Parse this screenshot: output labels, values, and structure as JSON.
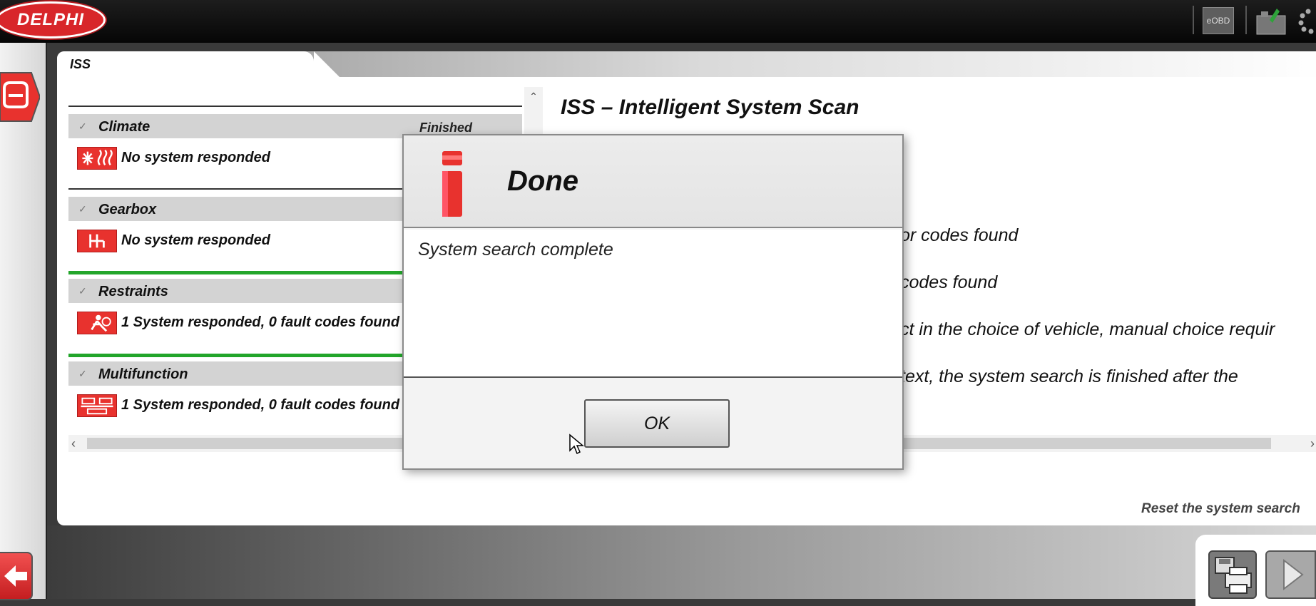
{
  "app": {
    "brand": "DELPHI"
  },
  "toolbar": {
    "eobd_label": "eOBD"
  },
  "tab": {
    "label": "ISS"
  },
  "groups": [
    {
      "name": "Climate",
      "state": "Finished",
      "result": "No system responded"
    },
    {
      "name": "Gearbox",
      "state": "",
      "result": "No system responded"
    },
    {
      "name": "Restraints",
      "state": "",
      "result": "1 System responded, 0 fault codes found"
    },
    {
      "name": "Multifunction",
      "state": "",
      "result": "1 System responded, 0 fault codes found"
    }
  ],
  "info": {
    "title": "ISS – Intelligent System Scan",
    "lines": [
      "or codes found",
      "codes found",
      "ct in the choice of vehicle, manual choice requir",
      " text, the system search is finished after the"
    ]
  },
  "reset_label": "Reset the system search",
  "dialog": {
    "title": "Done",
    "message": "System search complete",
    "ok_label": "OK"
  },
  "colors": {
    "brand_red": "#d8262a",
    "status_green": "#22a52a"
  }
}
